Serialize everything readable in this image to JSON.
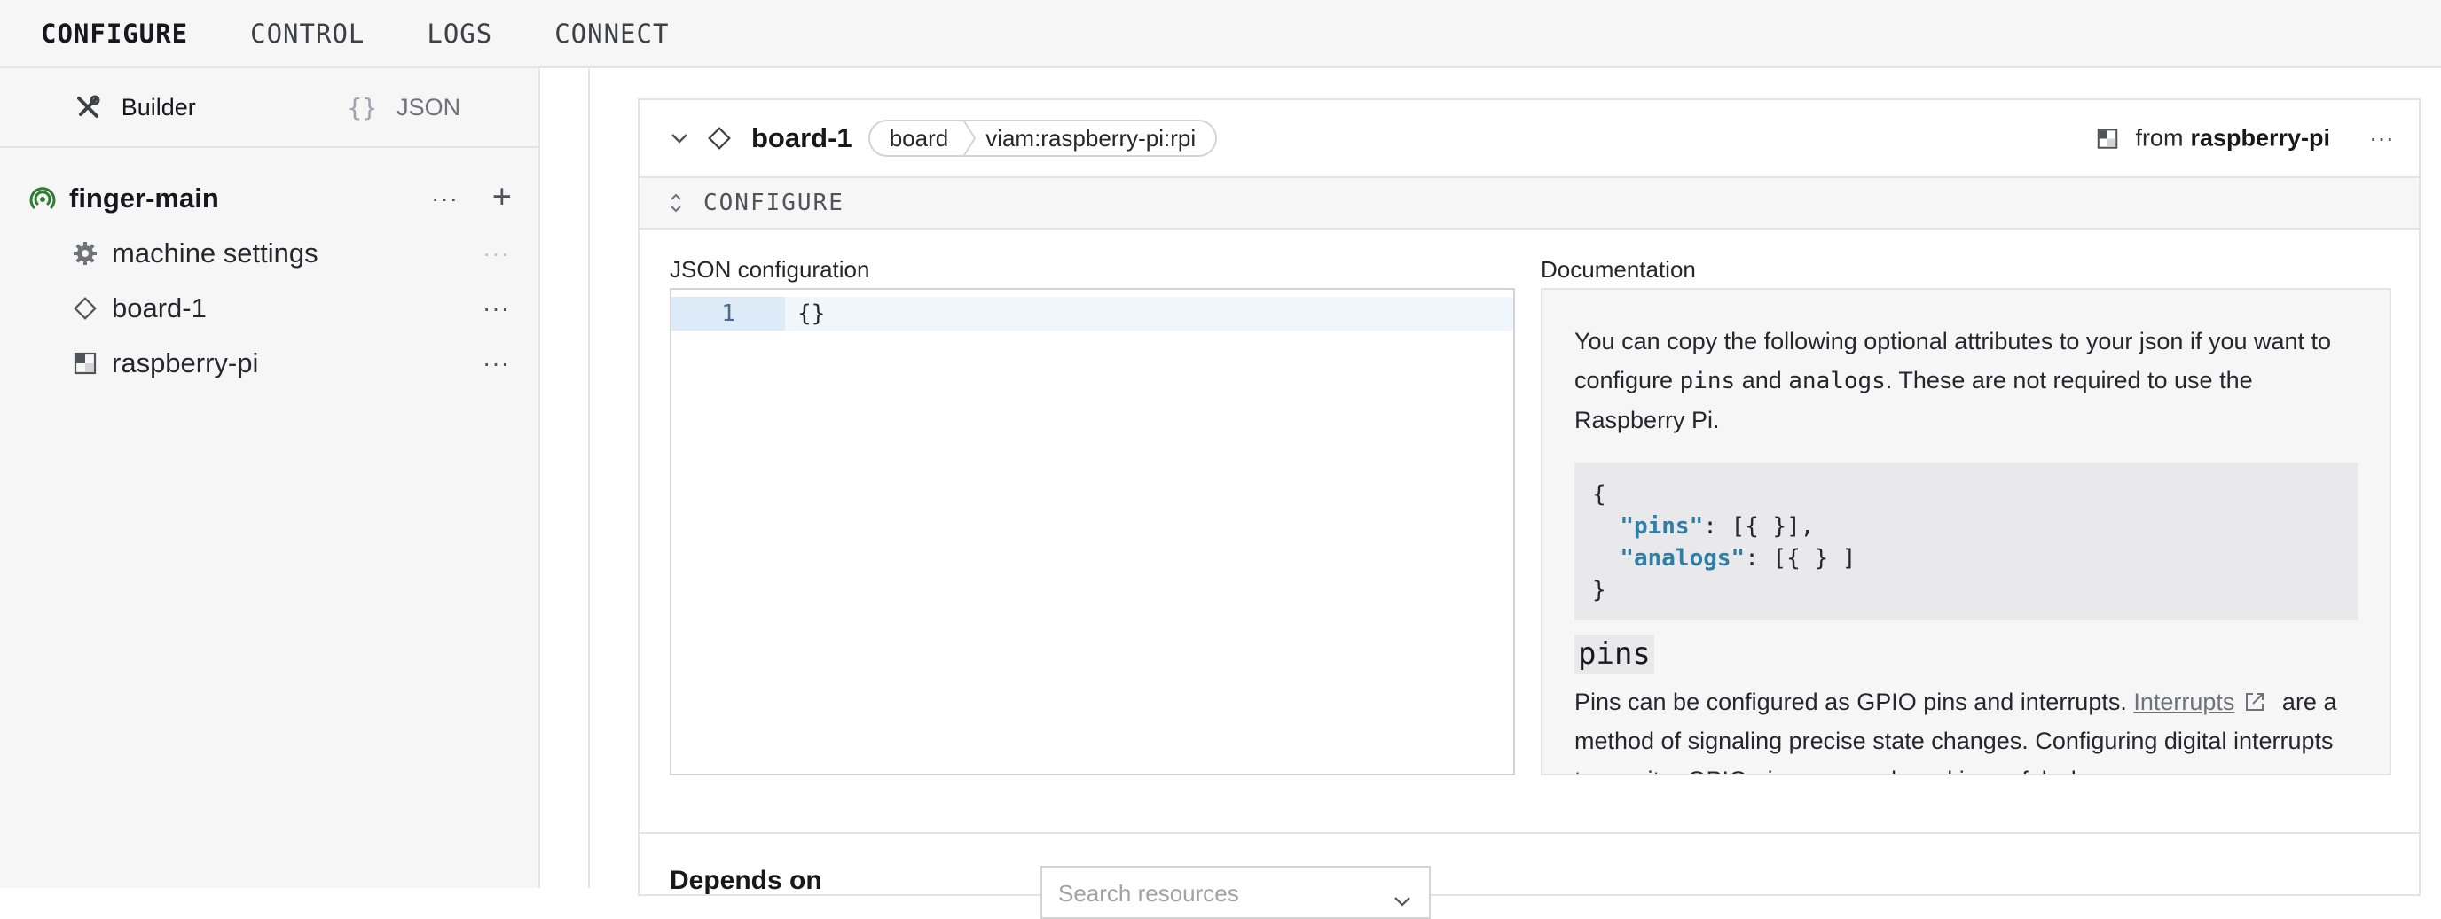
{
  "topnav": {
    "items": [
      {
        "label": "CONFIGURE",
        "active": true
      },
      {
        "label": "CONTROL",
        "active": false
      },
      {
        "label": "LOGS",
        "active": false
      },
      {
        "label": "CONNECT",
        "active": false
      }
    ]
  },
  "sidebar": {
    "modes": [
      {
        "label": "Builder",
        "icon": "tools-icon",
        "active": true
      },
      {
        "label": "JSON",
        "icon": "{}",
        "active": false
      }
    ],
    "tree": {
      "root": {
        "label": "finger-main",
        "icon": "signal-icon",
        "menu": "···",
        "add": "+"
      },
      "children": [
        {
          "label": "machine settings",
          "icon": "gear-icon",
          "menu": "···"
        },
        {
          "label": "board-1",
          "icon": "diamond-icon",
          "menu": "···"
        },
        {
          "label": "raspberry-pi",
          "icon": "module-icon",
          "menu": "···"
        }
      ]
    }
  },
  "card": {
    "name": "board-1",
    "chip_type": "board",
    "chip_model": "viam:raspberry-pi:rpi",
    "from_prefix": "from",
    "from_source": "raspberry-pi",
    "menu": "···",
    "section_title": "CONFIGURE",
    "json_label": "JSON configuration",
    "editor": {
      "line_number": "1",
      "code": "{}"
    },
    "doc_label": "Documentation",
    "doc": {
      "intro_1": "You can copy the following optional attributes to your json if you want to configure ",
      "intro_code_1": "pins",
      "intro_and": " and ",
      "intro_code_2": "analogs",
      "intro_2": ". These are not required to use the Raspberry Pi.",
      "code_open": "{",
      "code_pins_key": "\"pins\"",
      "code_pins_val": ": [{ }],",
      "code_analogs_key": "\"analogs\"",
      "code_analogs_val": ": [{ } ]",
      "code_close": "}",
      "heading": "pins",
      "body_1": "Pins can be configured as GPIO pins and interrupts. ",
      "link": "Interrupts",
      "body_2": " are a method of signaling precise state changes. Configuring digital interrupts to monitor GPIO pins on your board is useful when"
    },
    "depends_title": "Depends on",
    "search_placeholder": "Search resources"
  },
  "colors": {
    "accent_green": "#2f7d32",
    "code_key": "#2e7ea6",
    "editor_highlight": "#f0f7fc"
  }
}
